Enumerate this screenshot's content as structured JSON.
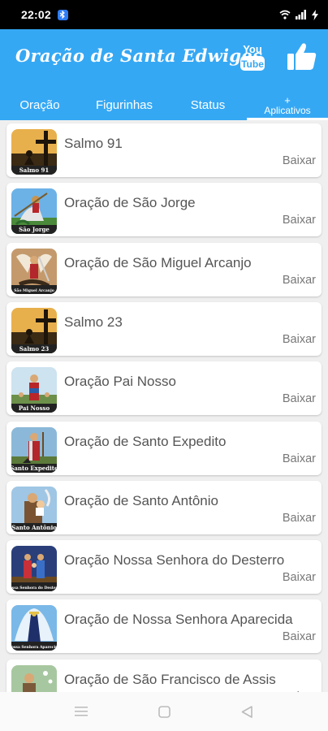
{
  "status_bar": {
    "time": "22:02",
    "notification_icon": "bluetooth-icon",
    "right_icons": [
      "wifi-icon",
      "signal-icon",
      "charging-icon"
    ]
  },
  "header": {
    "title": "Oração de Santa Edwiges",
    "youtube_icon": "youtube-icon",
    "like_icon": "thumbs-up-icon",
    "colors": {
      "primary": "#35a8f4"
    }
  },
  "tabs": [
    {
      "label": "Oração",
      "active": false
    },
    {
      "label": "Figurinhas",
      "active": false
    },
    {
      "label": "Status",
      "active": false
    },
    {
      "label_plus": "+",
      "label": "Aplicativos",
      "active": true
    }
  ],
  "apps": [
    {
      "title": "Salmo 91",
      "action": "Baixar",
      "thumb_caption": "Salmo 91",
      "thumb_theme": "cross"
    },
    {
      "title": "Oração de São Jorge",
      "action": "Baixar",
      "thumb_caption": "São Jorge",
      "thumb_theme": "jorge"
    },
    {
      "title": "Oração de São Miguel Arcanjo",
      "action": "Baixar",
      "thumb_caption": "São Miguel Arcanjo",
      "thumb_theme": "miguel"
    },
    {
      "title": "Salmo 23",
      "action": "Baixar",
      "thumb_caption": "Salmo 23",
      "thumb_theme": "cross"
    },
    {
      "title": "Oração Pai Nosso",
      "action": "Baixar",
      "thumb_caption": "Pai Nosso",
      "thumb_theme": "painosso"
    },
    {
      "title": "Oração de Santo Expedito",
      "action": "Baixar",
      "thumb_caption": "Santo Expedito",
      "thumb_theme": "expedito"
    },
    {
      "title": "Oração de Santo Antônio",
      "action": "Baixar",
      "thumb_caption": "Santo Antônio",
      "thumb_theme": "antonio"
    },
    {
      "title": "Oração Nossa Senhora do Desterro",
      "action": "Baixar",
      "thumb_caption": "Nossa Senhora do Desterro",
      "thumb_theme": "desterro"
    },
    {
      "title": "Oração de Nossa Senhora Aparecida",
      "action": "Baixar",
      "thumb_caption": "Nossa Senhora Aparecida",
      "thumb_theme": "aparecida"
    },
    {
      "title": "Oração de São Francisco de Assis",
      "action": "Baixar",
      "thumb_caption": "",
      "thumb_theme": "francisco"
    }
  ],
  "nav_bar": {
    "icons": [
      "menu-icon",
      "home-square-icon",
      "back-triangle-icon"
    ]
  }
}
